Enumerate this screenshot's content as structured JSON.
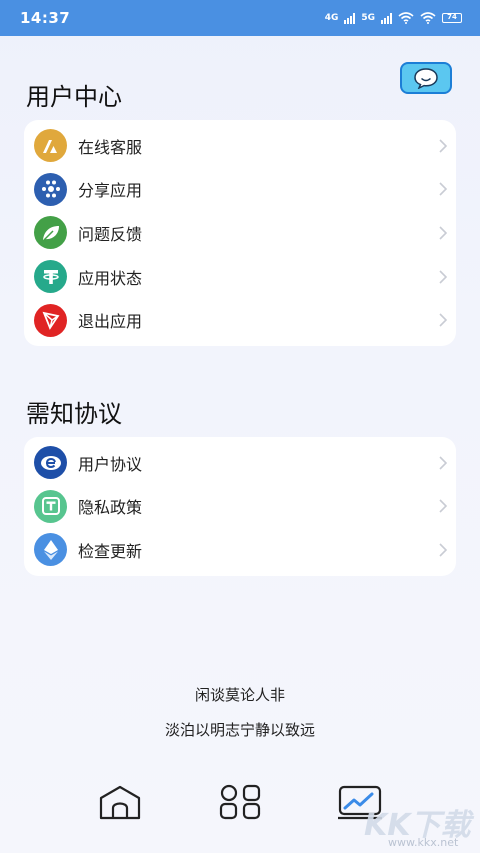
{
  "status_bar": {
    "time": "14:37",
    "net1": "4G",
    "net2": "5G",
    "battery": "74"
  },
  "user_center": {
    "title": "用户中心",
    "items": [
      {
        "label": "在线客服",
        "icon": "support-icon",
        "color": "#e0a83c"
      },
      {
        "label": "分享应用",
        "icon": "share-icon",
        "color": "#2d5fb0"
      },
      {
        "label": "问题反馈",
        "icon": "feedback-leaf-icon",
        "color": "#43a047"
      },
      {
        "label": "应用状态",
        "icon": "status-icon",
        "color": "#26a98b"
      },
      {
        "label": "退出应用",
        "icon": "exit-icon",
        "color": "#e02424"
      }
    ]
  },
  "agreements": {
    "title": "需知协议",
    "items": [
      {
        "label": "用户协议",
        "icon": "user-agreement-icon",
        "color": "#1e4fa8"
      },
      {
        "label": "隐私政策",
        "icon": "privacy-icon",
        "color": "#57c58f"
      },
      {
        "label": "检查更新",
        "icon": "update-diamond-icon",
        "color": "#4a90e2"
      }
    ]
  },
  "motto": {
    "line1": "闲谈莫论人非",
    "line2": "淡泊以明志宁静以致远"
  },
  "tabs": [
    {
      "name": "home-tab",
      "icon": "home-icon"
    },
    {
      "name": "apps-tab",
      "icon": "grid-icon"
    },
    {
      "name": "stats-tab",
      "icon": "chart-icon"
    }
  ],
  "watermark": {
    "brand": "KK下载",
    "site": "www.kkx.net"
  }
}
